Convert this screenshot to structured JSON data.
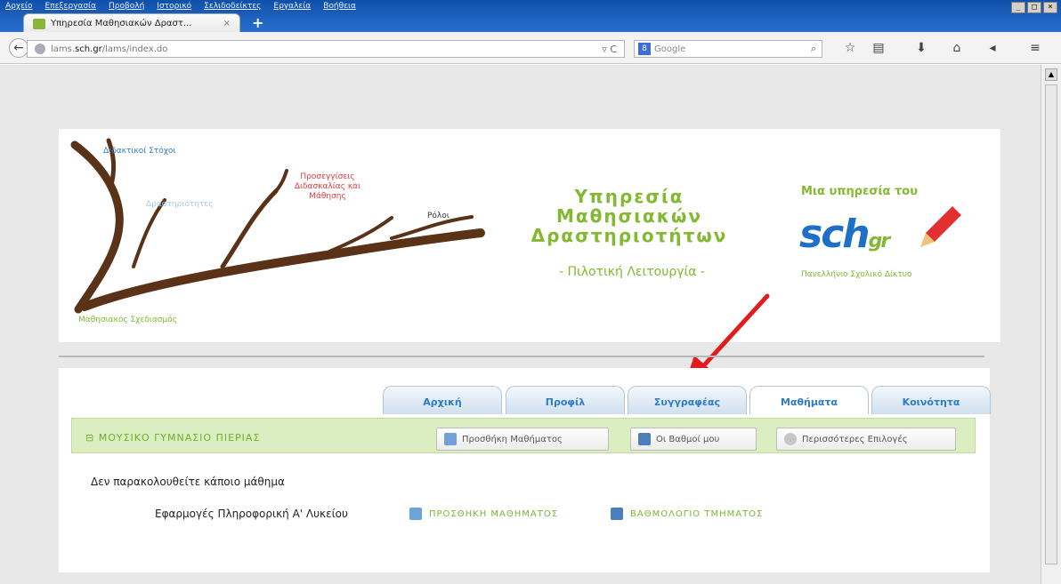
{
  "menu": [
    "Αρχείο",
    "Επεξεργασία",
    "Προβολή",
    "Ιστορικό",
    "Σελιδοδείκτες",
    "Εργαλεία",
    "Βοήθεια"
  ],
  "window_controls": [
    "_",
    "□",
    "×"
  ],
  "tab": {
    "title": "Υπηρεσία Μαθησιακών Δραστ...",
    "close": "×",
    "new_tab": "+"
  },
  "nav": {
    "url_prefix": "lams.",
    "url_domain": "sch.gr",
    "url_suffix": "/lams/index.do",
    "reload": "▿ C",
    "search_placeholder": "Google",
    "search_engine_badge": "8"
  },
  "header": {
    "tree_labels": {
      "goals": "Διδακτικοί Στόχοι",
      "activities": "Δραστηριότητες",
      "approaches": "Προσεγγίσεις Διδασκαλίας και Μάθησης",
      "roles": "Ρόλοι",
      "design": "Μαθησιακός Σχεδιασμός"
    },
    "service_title_1": "Υπηρεσία",
    "service_title_2": "Μαθησιακών",
    "service_title_3": "Δραστηριοτήτων",
    "service_subtitle": "- Πιλοτική Λειτουργία -",
    "sch_tagline": "Μια υπηρεσία του",
    "sch_logo": "sch",
    "sch_logo_suffix": "gr",
    "sch_caption": "Πανελλήνιο Σχολικό Δίκτυο"
  },
  "tabs": [
    {
      "label": "Αρχική",
      "active": false
    },
    {
      "label": "Προφίλ",
      "active": false
    },
    {
      "label": "Συγγραφέας",
      "active": false
    },
    {
      "label": "Μαθήματα",
      "active": true
    },
    {
      "label": "Κοινότητα",
      "active": false
    }
  ],
  "main": {
    "school_name": "⊟ ΜΟΥΣΙΚΟ ΓΥΜΝΑΣΙΟ ΠΙΕΡΙΑΣ",
    "buttons": {
      "add_course": "Προσθήκη Μαθήματος",
      "my_grades": "Οι Βαθμοί μου",
      "more_options": "Περισσότερες Επιλογές"
    },
    "no_classes": "Δεν παρακολουθείτε κάποιο μάθημα",
    "course_name": "Εφαρμογές Πληροφορική Α' Λυκείου",
    "link_add_course": "ΠΡΟΣΘΗΚΗ ΜΑΘΗΜΑΤΟΣ",
    "link_gradebook": "ΒΑΘΜΟΛΟΓΙΟ ΤΜΗΜΑΤΟΣ"
  },
  "colors": {
    "accent_green": "#82b930",
    "tab_blue": "#2d7cc4",
    "arrow_red": "#e31b1b",
    "branch_brown": "#5a3218"
  }
}
